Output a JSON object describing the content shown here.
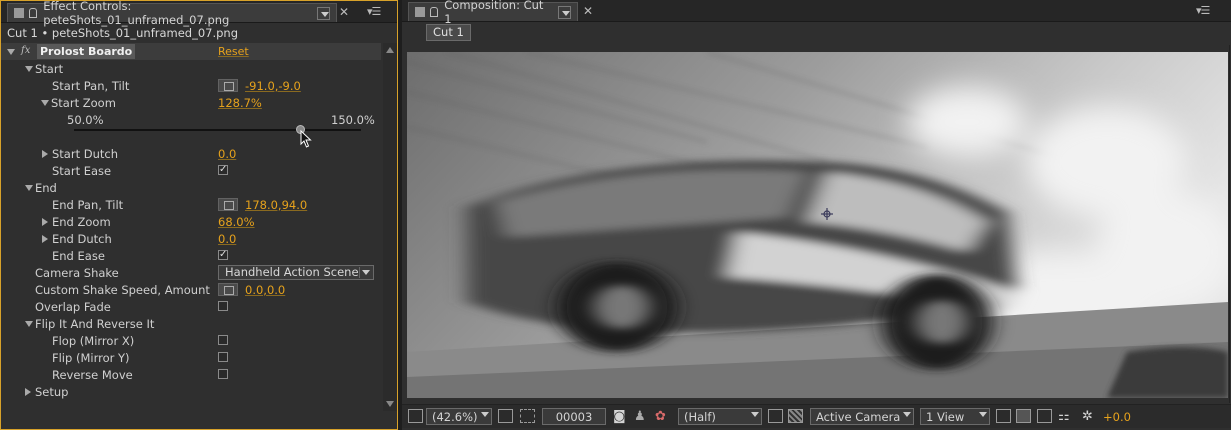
{
  "effect_panel": {
    "tab_title": "Effect Controls: peteShots_01_unframed_07.png",
    "layer_line": "Cut 1 • peteShots_01_unframed_07.png",
    "effect_name": "Prolost Boardo",
    "fx_badge": "fx",
    "reset_label": "Reset",
    "rows": {
      "start": "Start",
      "start_pan_tilt": "Start Pan, Tilt",
      "start_pan_tilt_value": "-91.0,-9.0",
      "start_zoom": "Start Zoom",
      "start_zoom_value": "128.7%",
      "slider_min": "50.0%",
      "slider_max": "150.0%",
      "start_dutch": "Start Dutch",
      "start_dutch_value": "0.0",
      "start_ease": "Start Ease",
      "end": "End",
      "end_pan_tilt": "End Pan, Tilt",
      "end_pan_tilt_value": "178.0,94.0",
      "end_zoom": "End Zoom",
      "end_zoom_value": "68.0%",
      "end_dutch": "End Dutch",
      "end_dutch_value": "0.0",
      "end_ease": "End Ease",
      "camera_shake": "Camera Shake",
      "camera_shake_value": "Handheld Action Scene",
      "custom_shake": "Custom Shake Speed, Amount",
      "custom_shake_value": "0.0,0.0",
      "overlap_fade": "Overlap Fade",
      "flip_group": "Flip It And Reverse It",
      "flop": "Flop (Mirror X)",
      "flip": "Flip (Mirror Y)",
      "reverse": "Reverse Move",
      "setup": "Setup"
    },
    "checkmark": "✓",
    "slider_value_percent": 78.7
  },
  "comp_panel": {
    "tab_title": "Composition: Cut 1",
    "subtab": "Cut 1",
    "bottom_bar": {
      "zoom": "(42.6%)",
      "timecode": "00003",
      "resolution": "(Half)",
      "camera": "Active Camera",
      "views": "1 View",
      "exposure": "+0.0"
    }
  },
  "colors": {
    "accent": "#e6a21c",
    "panel_border_active": "#d8a22a",
    "panel_bg": "#2f2f2f"
  },
  "icons": [
    "grip-icon",
    "lock-icon",
    "menu-icon",
    "close-icon",
    "fx-icon",
    "point-control-icon",
    "checkbox-icon",
    "cursor-icon",
    "snapshot-icon",
    "channels-icon",
    "grid-icon",
    "transparency-icon",
    "flowchart-icon",
    "exposure-icon"
  ]
}
